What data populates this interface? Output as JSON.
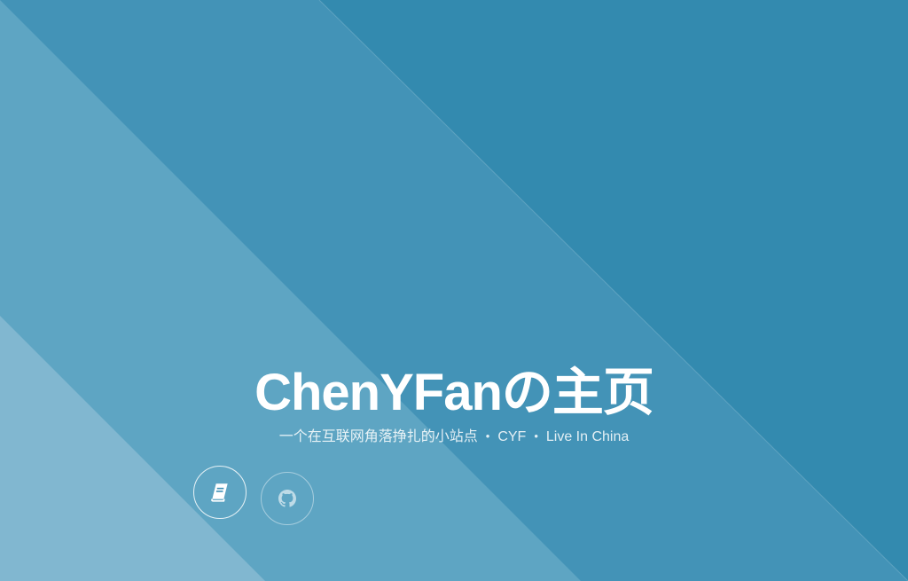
{
  "hero": {
    "title": "ChenYFanの主页",
    "subtitle_parts": [
      "一个在互联网角落挣扎的小站点",
      "CYF",
      "Live In China"
    ],
    "separator": "•"
  },
  "links": [
    {
      "icon": "book-icon",
      "label": "blog"
    },
    {
      "icon": "github-icon",
      "label": "github"
    }
  ],
  "colors": {
    "background": "#338aaf",
    "band_1": "#4393b7",
    "band_2": "#5ea5c3",
    "band_3": "#81b7d0",
    "text": "#ffffff"
  }
}
